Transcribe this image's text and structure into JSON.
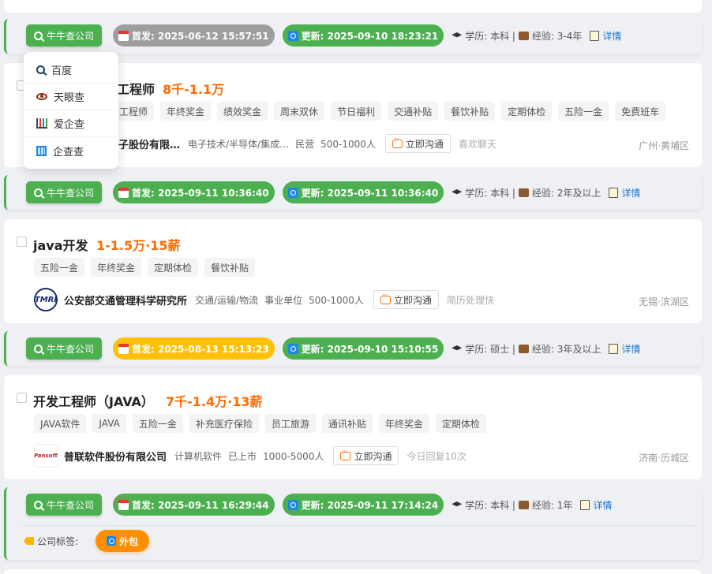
{
  "niuniu_label": "牛牛查公司",
  "detail_label": "详情",
  "chat_label": "立即沟通",
  "dropdown": {
    "items": [
      "百度",
      "天眼查",
      "爱企查",
      "企查查"
    ]
  },
  "bars": [
    {
      "first": "首发: 2025-06-12 15:57:51",
      "first_color": "gray",
      "update": "更新: 2025-09-10 18:23:21",
      "edu": "学历: 本科 |",
      "exp": "经验: 3-4年"
    },
    {
      "first": "首发: 2025-09-11 10:36:40",
      "first_color": "green",
      "update": "更新: 2025-09-11 10:36:40",
      "edu": "学历: 本科 |",
      "exp": "经验: 2年及以上"
    },
    {
      "first": "首发: 2025-08-13 15:13:23",
      "first_color": "yellow",
      "update": "更新: 2025-09-10 15:10:55",
      "edu": "学历: 硕士 |",
      "exp": "经验: 3年及以上"
    },
    {
      "first": "首发: 2025-09-11 16:29:44",
      "first_color": "green",
      "update": "更新: 2025-09-11 17:14:24",
      "edu": "学历: 本科 |",
      "exp": "经验: 1年"
    }
  ],
  "jobs": [
    {
      "title": "工程师",
      "salary": "8千-1.1万",
      "tags": [
        "工程师",
        "年终奖金",
        "绩效奖金",
        "周末双休",
        "节日福利",
        "交通补贴",
        "餐饮补贴",
        "定期体检",
        "五险一金",
        "免费班车"
      ],
      "company": "子股份有限…",
      "industry": "电子技术/半导体/集成…",
      "ownership": "民营",
      "size": "500-1000人",
      "hr": "喜欢聊天",
      "location": "广州·黄埔区"
    },
    {
      "title": "java开发",
      "salary": "1-1.5万·15薪",
      "tags": [
        "五险一金",
        "年终奖金",
        "定期体检",
        "餐饮补贴"
      ],
      "company": "公安部交通管理科学研究所",
      "logo_text": "TMRI",
      "industry": "交通/运输/物流",
      "ownership": "事业单位",
      "size": "500-1000人",
      "hr": "简历处理快",
      "location": "无锡·滨湖区"
    },
    {
      "title": "开发工程师（JAVA）",
      "salary": "7千-1.4万·13薪",
      "tags": [
        "JAVA软件",
        "JAVA",
        "五险一金",
        "补充医疗保险",
        "员工旅游",
        "通讯补贴",
        "年终奖金",
        "定期体检"
      ],
      "company": "普联软件股份有限公司",
      "logo_text": "Pansoft",
      "industry": "计算机软件",
      "ownership": "已上市",
      "size": "1000-5000人",
      "hr": "今日回复10次",
      "location": "济南·历城区"
    }
  ],
  "company_tags": {
    "label": "公司标签:",
    "items": [
      "外包"
    ]
  }
}
